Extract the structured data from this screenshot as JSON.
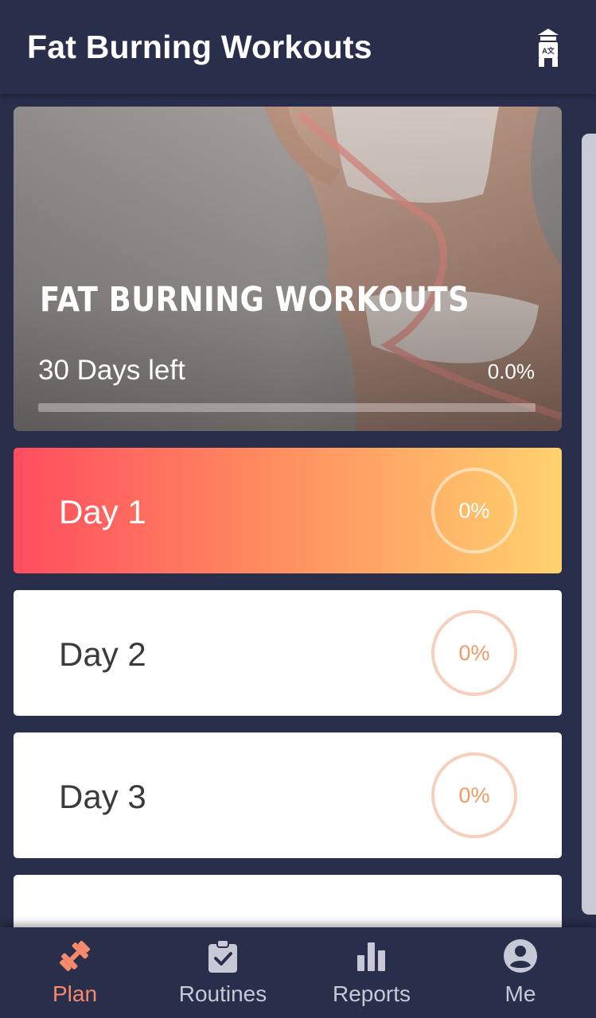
{
  "header": {
    "title": "Fat Burning Workouts",
    "translate_icon": "translate-icon"
  },
  "hero": {
    "title": "FAT BURNING WORKOUTS",
    "days_left": "30 Days left",
    "percent": "0.0%",
    "progress": 0.0
  },
  "days": [
    {
      "label": "Day 1",
      "percent": "0%",
      "active": true
    },
    {
      "label": "Day 2",
      "percent": "0%",
      "active": false
    },
    {
      "label": "Day 3",
      "percent": "0%",
      "active": false
    }
  ],
  "tabs": [
    {
      "label": "Plan",
      "icon": "dumbbell-icon",
      "active": true
    },
    {
      "label": "Routines",
      "icon": "clipboard-check-icon",
      "active": false
    },
    {
      "label": "Reports",
      "icon": "bar-chart-icon",
      "active": false
    },
    {
      "label": "Me",
      "icon": "account-icon",
      "active": false
    }
  ],
  "colors": {
    "background": "#292e4b",
    "accent": "#f78a6a",
    "active_gradient_start": "#ff4d5f",
    "active_gradient_end": "#ffd26e",
    "ring": "#f6d0bd"
  }
}
